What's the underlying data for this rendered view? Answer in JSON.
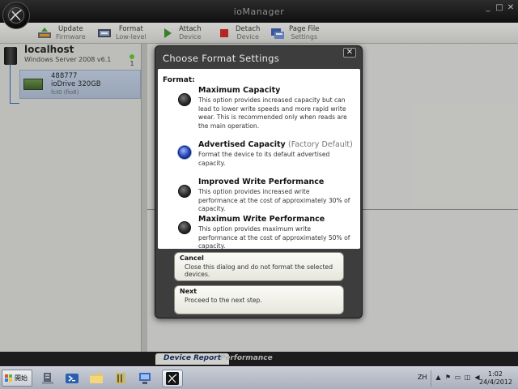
{
  "window": {
    "title": "ioManager",
    "controls": {
      "minimize": "_",
      "maximize": "□",
      "close": "✕"
    }
  },
  "toolbar": {
    "buttons": [
      {
        "line1": "Update",
        "line2": "Firmware",
        "icon": "update-firmware-icon"
      },
      {
        "line1": "Format",
        "line2": "Low-level",
        "icon": "format-icon"
      },
      {
        "line1": "Attach",
        "line2": "Device",
        "icon": "attach-icon"
      },
      {
        "line1": "Detach",
        "line2": "Device",
        "icon": "detach-icon"
      },
      {
        "line1": "Page File",
        "line2": "Settings",
        "icon": "page-file-icon"
      }
    ]
  },
  "sidebar": {
    "host": {
      "name": "localhost",
      "os": "Windows Server 2008 v6.1"
    },
    "indicator_count": "1",
    "device": {
      "serial": "488777",
      "name": "ioDrive 320GB",
      "sub": "fct0 (fio8)"
    }
  },
  "bottom_tabs": [
    "Device Report",
    "Performance"
  ],
  "dialog": {
    "title": "Choose Format Settings",
    "close_label": "✕",
    "format_label": "Format:",
    "options": [
      {
        "title": "Maximum Capacity",
        "subtitle": "",
        "description": "This option provides increased capacity but can lead to lower write speeds and more rapid write wear. This is recommended only when reads are the main operation.",
        "selected": false
      },
      {
        "title": "Advertised Capacity",
        "subtitle": "(Factory Default)",
        "description": "Format the device to its default advertised capacity.",
        "selected": true
      },
      {
        "title": "Improved Write Performance",
        "subtitle": "",
        "description": "This option provides increased write performance at the cost of approximately 30% of capacity.",
        "selected": false
      },
      {
        "title": "Maximum Write Performance",
        "subtitle": "",
        "description": "This option provides maximum write performance at the cost of approximately 50% of capacity.",
        "selected": false
      }
    ],
    "actions": [
      {
        "title": "Cancel",
        "description": "Close this dialog and do not format the selected devices."
      },
      {
        "title": "Next",
        "description": "Proceed to the next step."
      }
    ]
  },
  "taskbar": {
    "start_label": "開始",
    "language": "ZH",
    "clock_time": "1:02",
    "clock_date": "24/4/2012",
    "colors": {
      "flag_red": "#e84c2b",
      "flag_green": "#5fb336",
      "flag_blue": "#2a7fd8",
      "flag_yellow": "#f4c21c"
    }
  }
}
